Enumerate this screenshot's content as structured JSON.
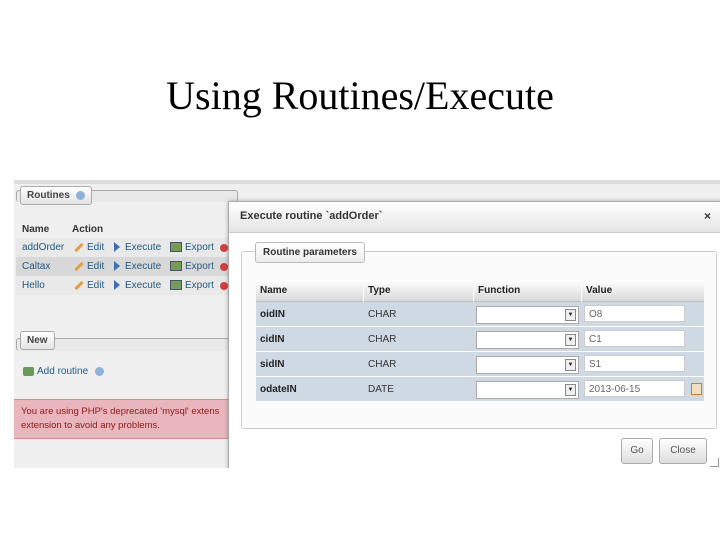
{
  "slide": {
    "title": "Using Routines/Execute"
  },
  "routines": {
    "legend": "Routines",
    "columns": {
      "name": "Name",
      "action": "Action"
    },
    "rows": [
      {
        "name": "addOrder",
        "edit": "Edit",
        "execute": "Execute",
        "export": "Export"
      },
      {
        "name": "Caltax",
        "edit": "Edit",
        "execute": "Execute",
        "export": "Export"
      },
      {
        "name": "Hello",
        "edit": "Edit",
        "execute": "Execute",
        "export": "Export"
      }
    ],
    "new_legend": "New",
    "add_routine": "Add routine",
    "warning_line1": "You are using PHP's deprecated 'mysql' extens",
    "warning_line2": "extension to avoid any problems."
  },
  "dialog": {
    "title": "Execute routine `addOrder`",
    "close": "×",
    "fieldset": "Routine parameters",
    "columns": {
      "name": "Name",
      "type": "Type",
      "function": "Function",
      "value": "Value"
    },
    "params": [
      {
        "name": "oidIN",
        "type": "CHAR",
        "value": "O8"
      },
      {
        "name": "cidIN",
        "type": "CHAR",
        "value": "C1"
      },
      {
        "name": "sidIN",
        "type": "CHAR",
        "value": "S1"
      },
      {
        "name": "odateIN",
        "type": "DATE",
        "value": "2013-06-15"
      }
    ],
    "go": "Go",
    "close_button": "Close"
  }
}
